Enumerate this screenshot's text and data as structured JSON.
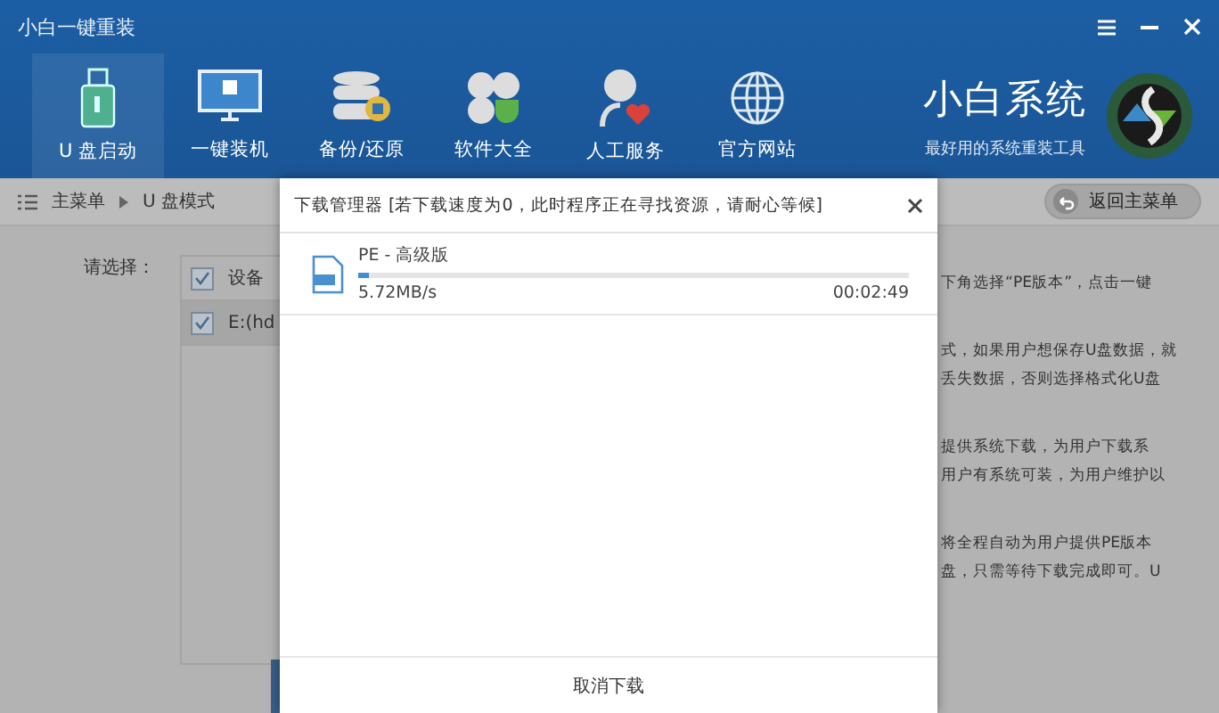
{
  "window": {
    "title": "小白一键重装"
  },
  "nav": [
    {
      "label": "U 盘启动",
      "selected": true
    },
    {
      "label": "一键装机",
      "selected": false
    },
    {
      "label": "备份/还原",
      "selected": false
    },
    {
      "label": "软件大全",
      "selected": false
    },
    {
      "label": "人工服务",
      "selected": false
    },
    {
      "label": "官方网站",
      "selected": false
    }
  ],
  "brand": {
    "name": "小白系统",
    "slogan": "最好用的系统重装工具"
  },
  "breadcrumb": [
    "主菜单",
    "U 盘模式"
  ],
  "back_button": "返回主菜单",
  "prompt": "请选择：",
  "device_table": {
    "header": "设备",
    "header_checked": true,
    "rows": [
      {
        "device": "E:(hd",
        "checked": true
      }
    ]
  },
  "description_lines": [
    "下角选择“PE版本”，点击一键",
    "式，如果用户想保存U盘数据，就",
    "丢失数据，否则选择格式化U盘",
    "提供系统下载，为用户下载系",
    "用户有系统可装，为用户维护以",
    "将全程自动为用户提供PE版本",
    "盘，只需等待下载完成即可。U"
  ],
  "dialog": {
    "title": "下载管理器 [若下载速度为0，此时程序正在寻找资源，请耐心等候]",
    "downloads": [
      {
        "name": "PE - 高级版",
        "level": 0.02,
        "speed": "5.72MB/s",
        "time": "00:02:49"
      }
    ],
    "cancel": "取消下载"
  }
}
